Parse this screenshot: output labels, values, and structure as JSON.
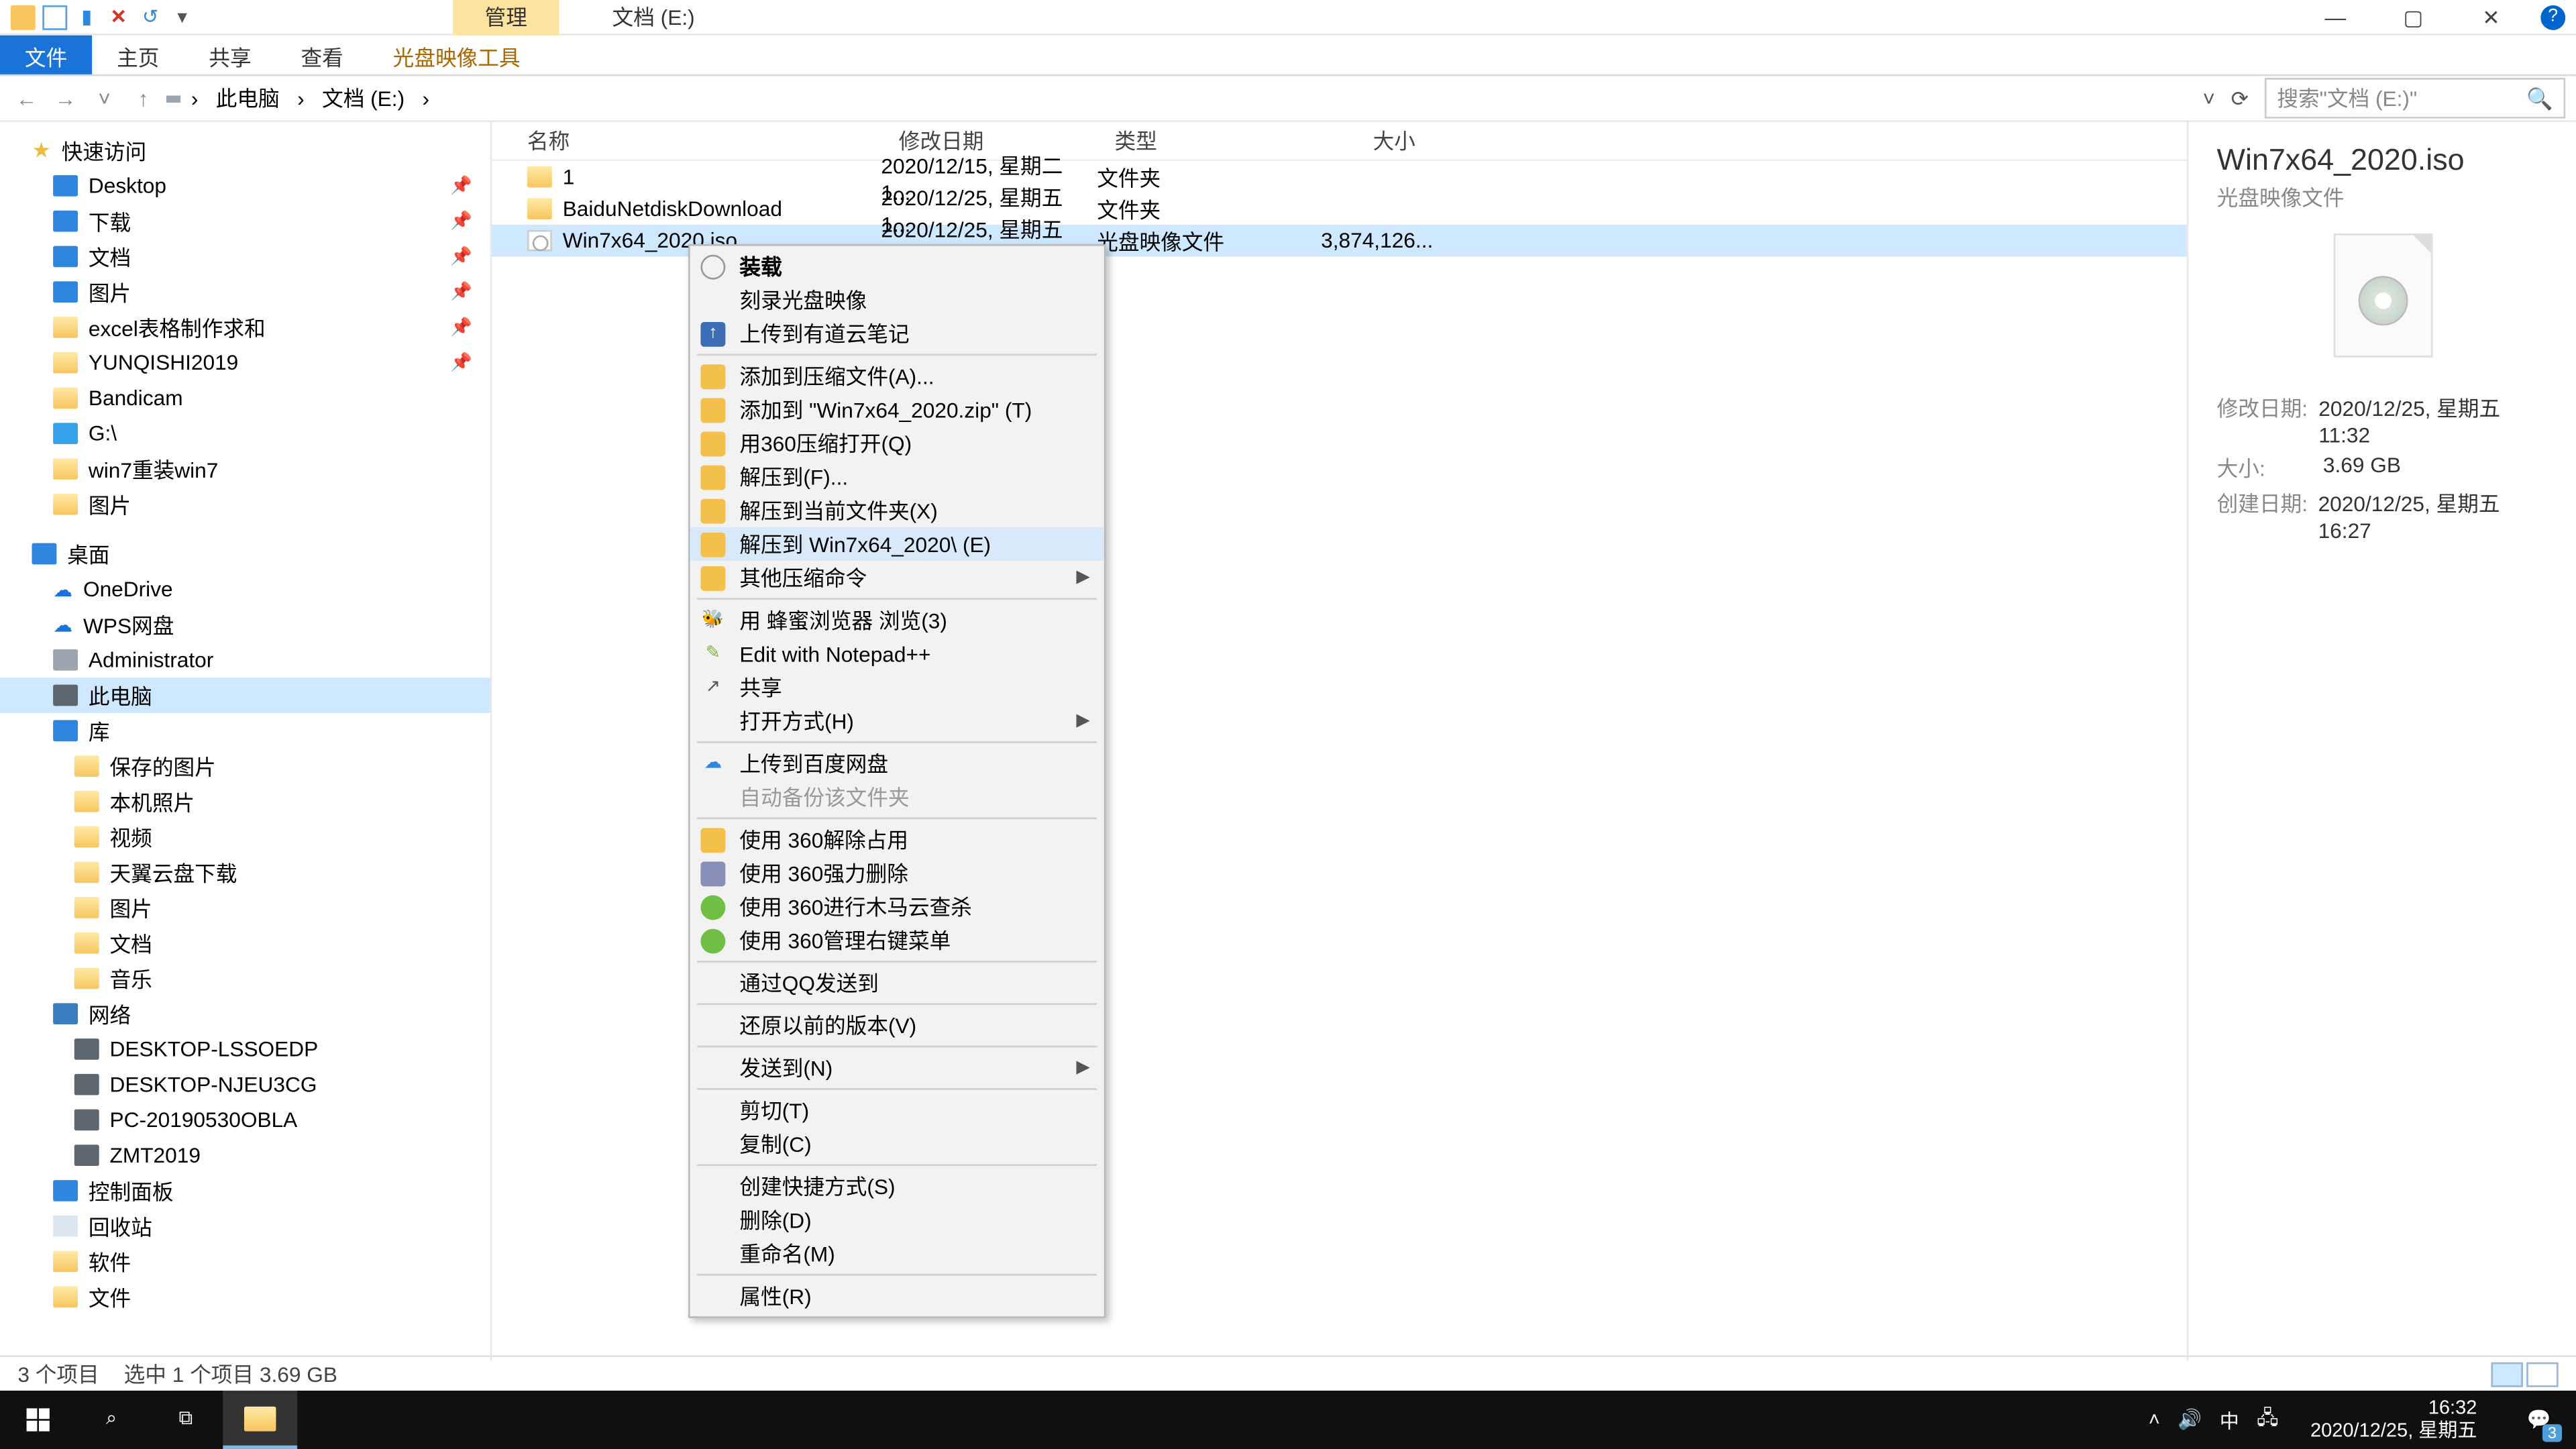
{
  "titlebar": {
    "manage_tab": "管理",
    "title": "文档 (E:)"
  },
  "ribbon": {
    "file": "文件",
    "home": "主页",
    "share": "共享",
    "view": "查看",
    "iso_tools": "光盘映像工具"
  },
  "address": {
    "root": "此电脑",
    "loc": "文档 (E:)",
    "search_placeholder": "搜索\"文档 (E:)\""
  },
  "sidebar": {
    "quick": "快速访问",
    "desktop": "Desktop",
    "downloads": "下载",
    "docs": "文档",
    "pics": "图片",
    "excel": "excel表格制作求和",
    "yunqishi": "YUNQISHI2019",
    "bandicam": "Bandicam",
    "gdrive": "G:\\",
    "win7re": "win7重装win7",
    "pics2": "图片",
    "desk_cn": "桌面",
    "onedrive": "OneDrive",
    "wps": "WPS网盘",
    "admin": "Administrator",
    "thispc": "此电脑",
    "lib": "库",
    "saved_pics": "保存的图片",
    "local_photos": "本机照片",
    "video": "视频",
    "tianyi": "天翼云盘下载",
    "lib_pics": "图片",
    "lib_docs": "文档",
    "lib_music": "音乐",
    "network": "网络",
    "net1": "DESKTOP-LSSOEDP",
    "net2": "DESKTOP-NJEU3CG",
    "net3": "PC-20190530OBLA",
    "net4": "ZMT2019",
    "ctrl_panel": "控制面板",
    "recycle": "回收站",
    "software": "软件",
    "files": "文件"
  },
  "columns": {
    "name": "名称",
    "date": "修改日期",
    "type": "类型",
    "size": "大小"
  },
  "rows": [
    {
      "name": "1",
      "date": "2020/12/15, 星期二 1...",
      "type": "文件夹",
      "size": ""
    },
    {
      "name": "BaiduNetdiskDownload",
      "date": "2020/12/25, 星期五 1...",
      "type": "文件夹",
      "size": ""
    },
    {
      "name": "Win7x64_2020.iso",
      "date": "2020/12/25, 星期五 1...",
      "type": "光盘映像文件",
      "size": "3,874,126..."
    }
  ],
  "ctx": {
    "mount": "装载",
    "burn": "刻录光盘映像",
    "youdao": "上传到有道云笔记",
    "addarc": "添加到压缩文件(A)...",
    "addzip": "添加到 \"Win7x64_2020.zip\" (T)",
    "open360": "用360压缩打开(Q)",
    "extF": "解压到(F)...",
    "extCur": "解压到当前文件夹(X)",
    "extDir": "解压到 Win7x64_2020\\ (E)",
    "other": "其他压缩命令",
    "honey": "用 蜂蜜浏览器 浏览(3)",
    "npp": "Edit with Notepad++",
    "shareit": "共享",
    "openwith": "打开方式(H)",
    "baidu": "上传到百度网盘",
    "autobak": "自动备份该文件夹",
    "u360a": "使用 360解除占用",
    "u360b": "使用 360强力删除",
    "u360c": "使用 360进行木马云查杀",
    "u360d": "使用 360管理右键菜单",
    "qq": "通过QQ发送到",
    "restore": "还原以前的版本(V)",
    "sendto": "发送到(N)",
    "cut": "剪切(T)",
    "copy": "复制(C)",
    "shortcut": "创建快捷方式(S)",
    "delete": "删除(D)",
    "rename": "重命名(M)",
    "props": "属性(R)"
  },
  "preview": {
    "title": "Win7x64_2020.iso",
    "sub": "光盘映像文件",
    "mdate_k": "修改日期:",
    "mdate_v": "2020/12/25, 星期五 11:32",
    "size_k": "大小:",
    "size_v": "3.69 GB",
    "cdate_k": "创建日期:",
    "cdate_v": "2020/12/25, 星期五 16:27"
  },
  "status": {
    "count": "3 个项目",
    "sel": "选中 1 个项目  3.69 GB"
  },
  "taskbar": {
    "ime": "中",
    "time": "16:32",
    "date": "2020/12/25, 星期五",
    "badge": "3"
  }
}
